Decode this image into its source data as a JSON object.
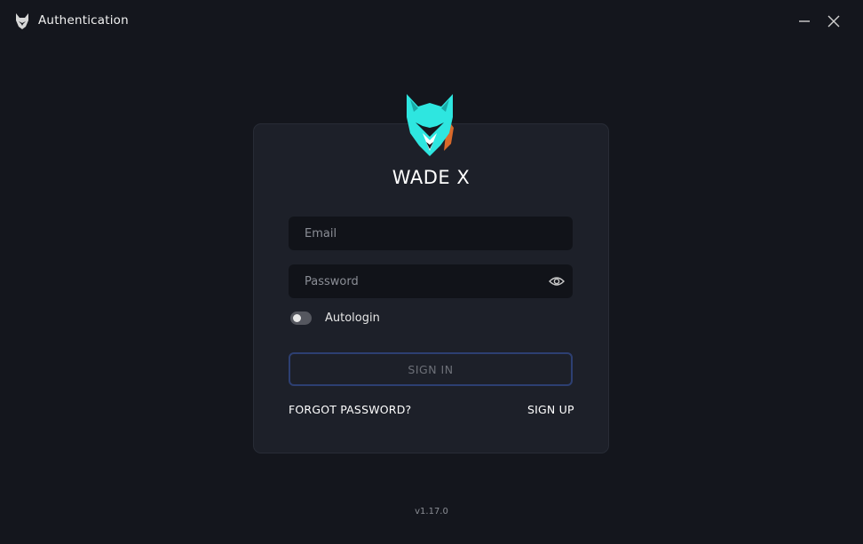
{
  "window": {
    "title": "Authentication",
    "icon": "wolf-logo-icon",
    "controls": {
      "minimize": "minimize-icon",
      "close": "close-icon"
    }
  },
  "brand": {
    "name": "WADE X",
    "logo": "wolf-logo-icon"
  },
  "form": {
    "email_placeholder": "Email",
    "email_value": "",
    "password_placeholder": "Password",
    "password_value": "",
    "password_toggle_icon": "eye-icon",
    "autologin_label": "Autologin",
    "autologin_enabled": false,
    "signin_label": "SIGN IN",
    "forgot_label": "FORGOT PASSWORD?",
    "signup_label": "SIGN UP"
  },
  "footer": {
    "version": "v1.17.0"
  },
  "colors": {
    "background": "#14161d",
    "card": "#1d2029",
    "input": "#111319",
    "signin_border": "#2d3f72",
    "logo_teal": "#2ee6e0",
    "logo_orange": "#d9692a"
  }
}
